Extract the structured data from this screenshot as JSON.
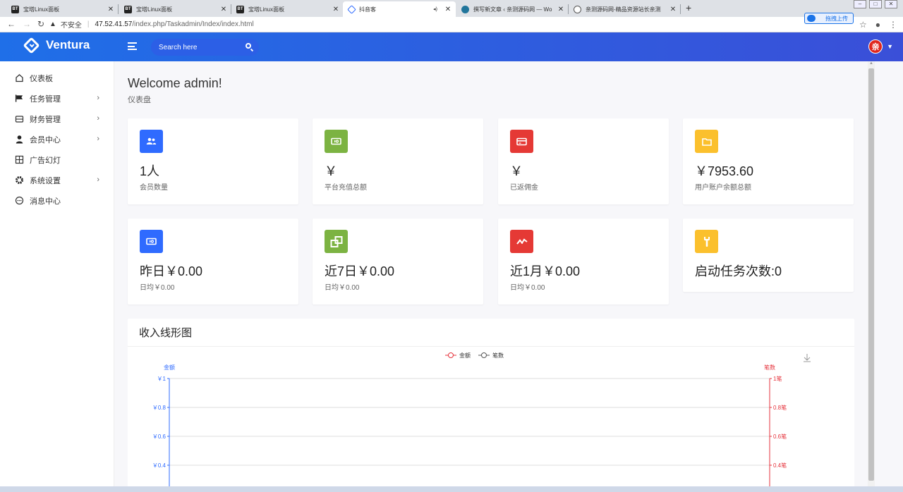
{
  "browser": {
    "tabs": [
      {
        "title": "宝塔Linux面板",
        "favicon": "bt-icon"
      },
      {
        "title": "宝塔Linux面板",
        "favicon": "bt-icon"
      },
      {
        "title": "宝塔Linux面板",
        "favicon": "bt-icon"
      },
      {
        "title": "抖音客",
        "favicon": "ventura-icon",
        "active": true
      },
      {
        "title": "撰写新文章 ‹ 亲测源码网 — Wo",
        "favicon": "wordpress-icon"
      },
      {
        "title": "亲测源码网-精品资源站长亲测",
        "favicon": "globe-icon"
      }
    ],
    "insecure_label": "不安全",
    "url_host": "47.52.41.57",
    "url_path": "/index.php/Taskadmin/Index/index.html",
    "extension_label": "拖拽上传"
  },
  "header": {
    "brand": "Ventura",
    "search_placeholder": "Search here",
    "avatar_text": "亲"
  },
  "sidebar": {
    "items": [
      {
        "label": "仪表板",
        "icon": "home-icon",
        "has_sub": false
      },
      {
        "label": "任务管理",
        "icon": "flag-icon",
        "has_sub": true
      },
      {
        "label": "财务管理",
        "icon": "wallet-icon",
        "has_sub": true
      },
      {
        "label": "会员中心",
        "icon": "user-icon",
        "has_sub": true
      },
      {
        "label": "广告幻灯",
        "icon": "grid-icon",
        "has_sub": false
      },
      {
        "label": "系统设置",
        "icon": "gear-icon",
        "has_sub": true
      },
      {
        "label": "消息中心",
        "icon": "message-icon",
        "has_sub": false
      }
    ]
  },
  "page": {
    "title": "Welcome admin!",
    "breadcrumb": "仪表盘"
  },
  "stats_row1": [
    {
      "value": "1人",
      "label": "会员数量",
      "icon": "users-icon",
      "color": "#2f6bff"
    },
    {
      "value": "￥",
      "label": "平台充值总额",
      "icon": "money-icon",
      "color": "#7cb342"
    },
    {
      "value": "￥",
      "label": "已返佣金",
      "icon": "card-icon",
      "color": "#e53935"
    },
    {
      "value": "￥7953.60",
      "label": "用户账户余额总额",
      "icon": "folder-icon",
      "color": "#fbc02d"
    }
  ],
  "stats_row2": [
    {
      "value": "昨日￥0.00",
      "label": "日均￥0.00",
      "icon": "money-icon",
      "color": "#2f6bff"
    },
    {
      "value": "近7日￥0.00",
      "label": "日均￥0.00",
      "icon": "copy-icon",
      "color": "#7cb342"
    },
    {
      "value": "近1月￥0.00",
      "label": "日均￥0.00",
      "icon": "trend-icon",
      "color": "#e53935"
    },
    {
      "value": "启动任务次数:0",
      "label": "",
      "icon": "wrench-icon",
      "color": "#fbc02d"
    }
  ],
  "chart": {
    "card_title": "收入线形图"
  },
  "chart_data": {
    "type": "line",
    "x": [],
    "series": [
      {
        "name": "金额",
        "values": [],
        "axis": "left",
        "color": "#e5323b"
      },
      {
        "name": "笔数",
        "values": [],
        "axis": "right",
        "color": "#555555"
      }
    ],
    "y_left": {
      "label": "金额",
      "ticks": [
        "￥1",
        "￥0.8",
        "￥0.6",
        "￥0.4"
      ],
      "range": [
        0,
        1
      ],
      "color": "#2f6bff"
    },
    "y_right": {
      "label": "笔数",
      "ticks": [
        "1笔",
        "0.8笔",
        "0.6笔",
        "0.4笔"
      ],
      "range": [
        0,
        1
      ],
      "color": "#e5323b"
    },
    "legend": "top-center",
    "grid": true
  }
}
